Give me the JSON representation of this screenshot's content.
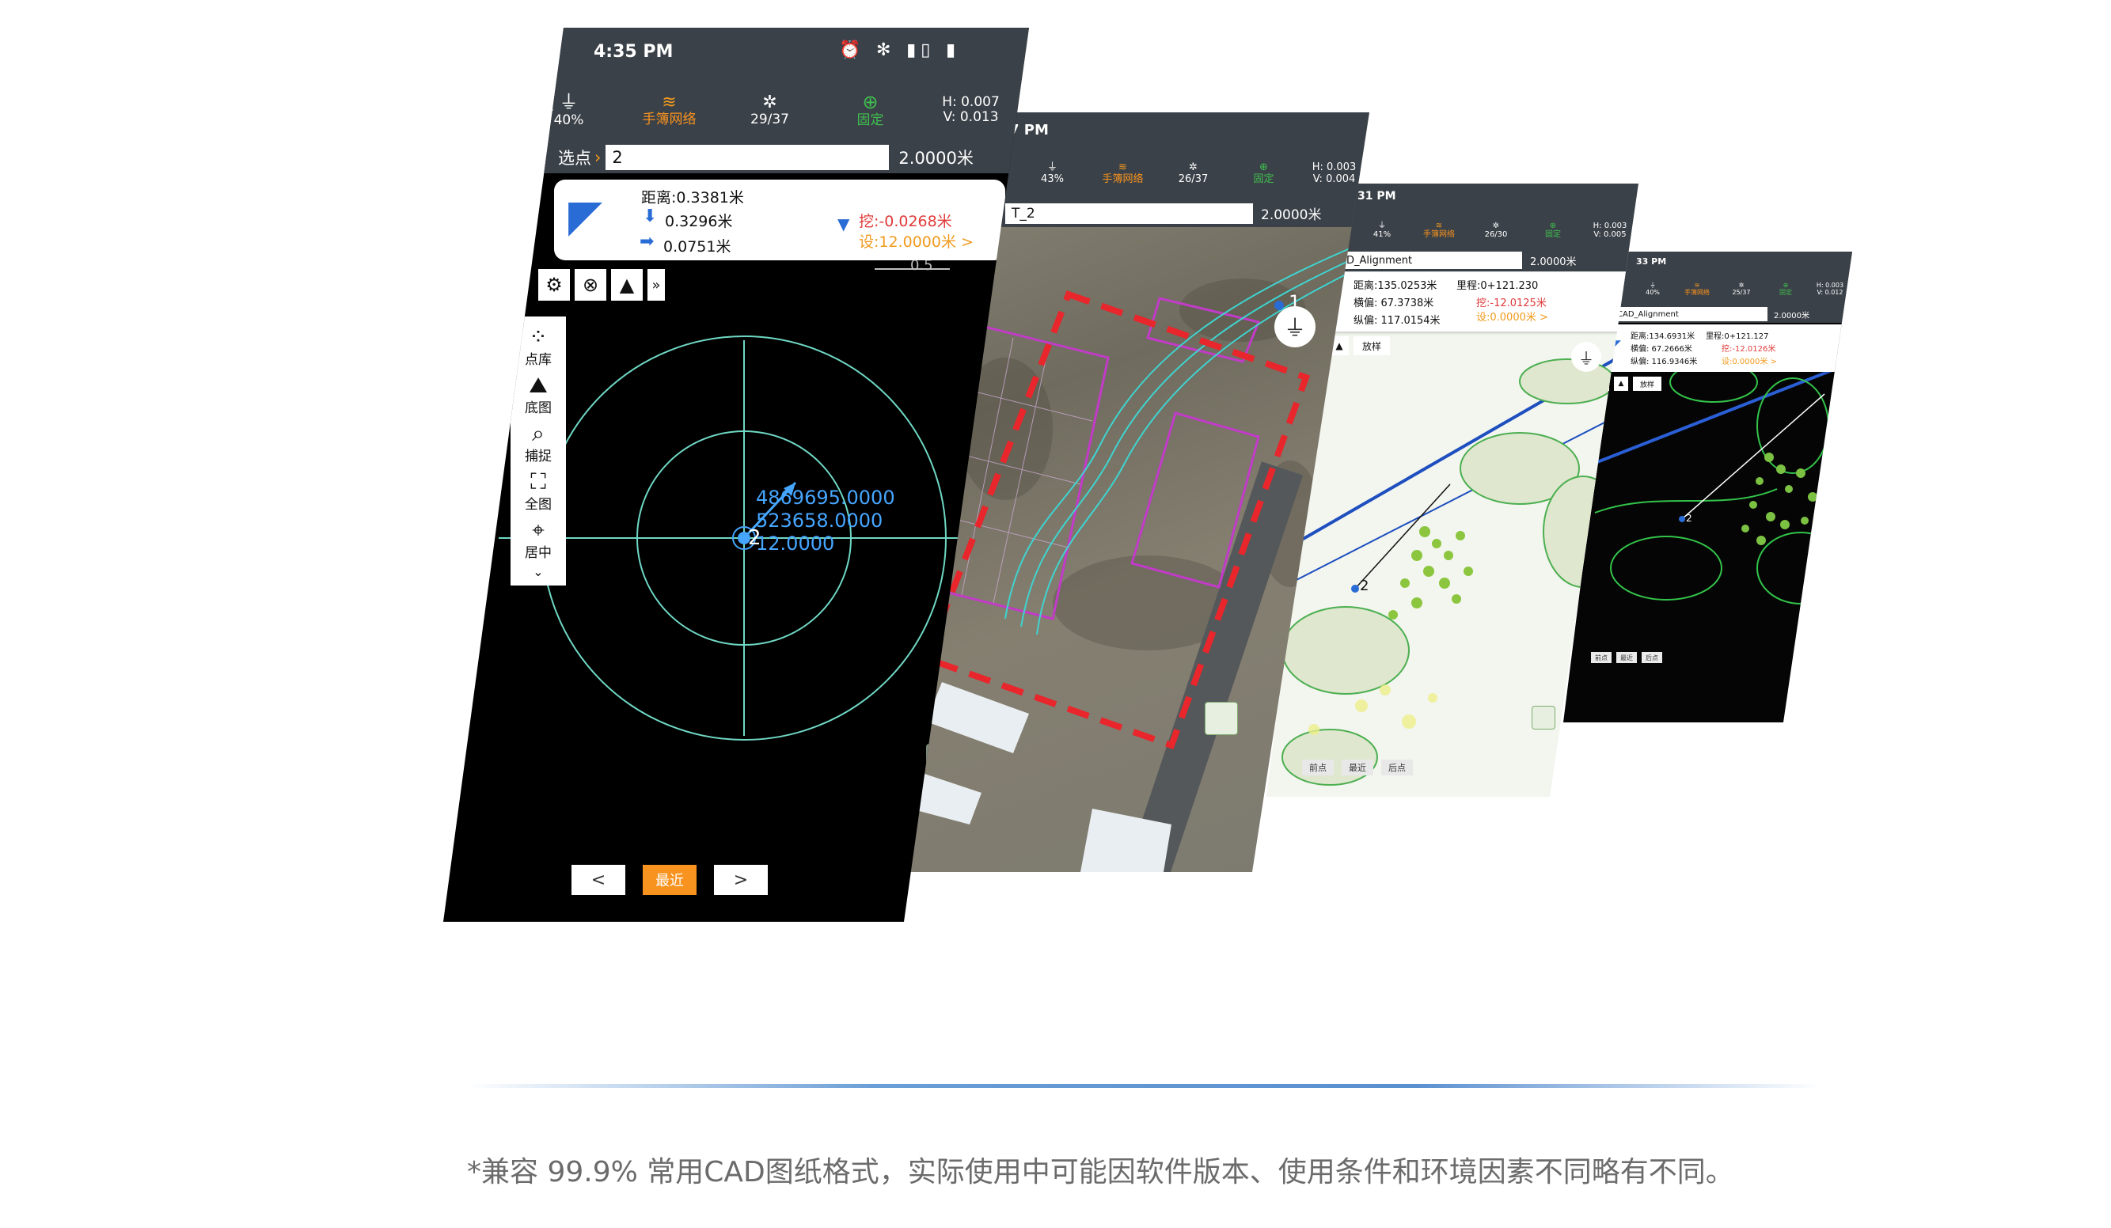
{
  "phone1": {
    "status": {
      "time": "4:35 PM"
    },
    "toolbar": {
      "battery": "40%",
      "network": "手簿网络",
      "satellites": "29/37",
      "fix": "固定",
      "h": "H: 0.007",
      "v": "V: 0.013"
    },
    "point": {
      "label": "选点",
      "value": "2",
      "pole": "2.0000米"
    },
    "card": {
      "distance": "距离:0.3381米",
      "north": "0.3296米",
      "east": "0.0751米",
      "cut": "挖:-0.0268米",
      "design": "设:12.0000米 >"
    },
    "side_tools": [
      "点库",
      "底图",
      "捕捉",
      "全图",
      "居中"
    ],
    "coords": [
      "4869695.0000",
      "523658.0000",
      "12.0000"
    ],
    "point_marker": "2",
    "scale_label": "0.5",
    "nav": {
      "prev": "<",
      "nearest": "最近",
      "next": ">"
    }
  },
  "phone2": {
    "status": {
      "time": "7 PM"
    },
    "toolbar": {
      "battery": "43%",
      "network": "手簿网络",
      "satellites": "26/37",
      "fix": "固定",
      "h": "H: 0.003",
      "v": "V: 0.004"
    },
    "point": {
      "value": "T_2",
      "pole": "2.0000米"
    },
    "point_marker": "1"
  },
  "phone3": {
    "status": {
      "time": "31 PM"
    },
    "toolbar": {
      "battery": "41%",
      "network": "手簿网络",
      "satellites": "26/30",
      "fix": "固定",
      "h": "H: 0.003",
      "v": "V: 0.005"
    },
    "point": {
      "value": "CAD_Alignment",
      "pole": "2.0000米"
    },
    "card": {
      "distance": "距离:135.0253米",
      "station": "里程:0+121.230",
      "offset": "横偏: 67.3738米",
      "along": "纵偏: 117.0154米",
      "cut": "挖:-12.0125米",
      "design": "设:0.0000米 >"
    },
    "tool_label": "放样",
    "point_marker": "2",
    "nav": {
      "prev": "前点",
      "nearest": "最近",
      "next": "后点"
    }
  },
  "phone4": {
    "status": {
      "time": "33 PM"
    },
    "toolbar": {
      "battery": "40%",
      "network": "手簿网络",
      "satellites": "25/37",
      "fix": "固定",
      "h": "H: 0.003",
      "v": "V: 0.012"
    },
    "point": {
      "value": "CAD_Alignment",
      "pole": "2.0000米"
    },
    "card": {
      "distance": "距离:134.6931米",
      "station": "里程:0+121.127",
      "offset": "横偏: 67.2666米",
      "along": "纵偏: 116.9346米",
      "cut": "挖:-12.0126米",
      "design": "设:0.0000米 >"
    },
    "tool_label": "放样",
    "point_marker": "2",
    "nav": {
      "prev": "前点",
      "nearest": "最近",
      "next": "后点"
    }
  },
  "footer": {
    "disclaimer": "*兼容 99.9% 常用CAD图纸格式，实际使用中可能因软件版本、使用条件和环境因素不同略有不同。"
  },
  "colors": {
    "accent_orange": "#f7931e",
    "fix_green": "#3fbf4f",
    "cut_red": "#e03b3b",
    "toolbar_gray": "#3b4148",
    "divider_blue": "#5a8fd0"
  }
}
